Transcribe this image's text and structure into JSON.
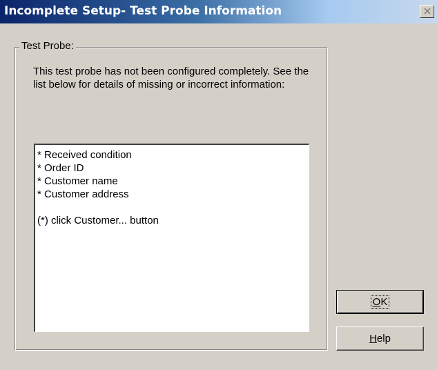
{
  "window": {
    "title": "Incomplete Setup- Test Probe Information"
  },
  "groupbox": {
    "label": "Test Probe:",
    "description": "This test probe has not been configured completely. See the list below for details of missing or incorrect information:"
  },
  "list": {
    "items": [
      "* Received condition",
      "* Order ID",
      "* Customer name",
      "* Customer address",
      "",
      "(*) click Customer... button"
    ]
  },
  "buttons": {
    "ok": {
      "mnemonic": "O",
      "rest": "K"
    },
    "help": {
      "mnemonic": "H",
      "rest": "elp"
    }
  },
  "colors": {
    "title_start": "#0a246a",
    "title_end": "#a6caf0",
    "face": "#d4d0c8"
  }
}
